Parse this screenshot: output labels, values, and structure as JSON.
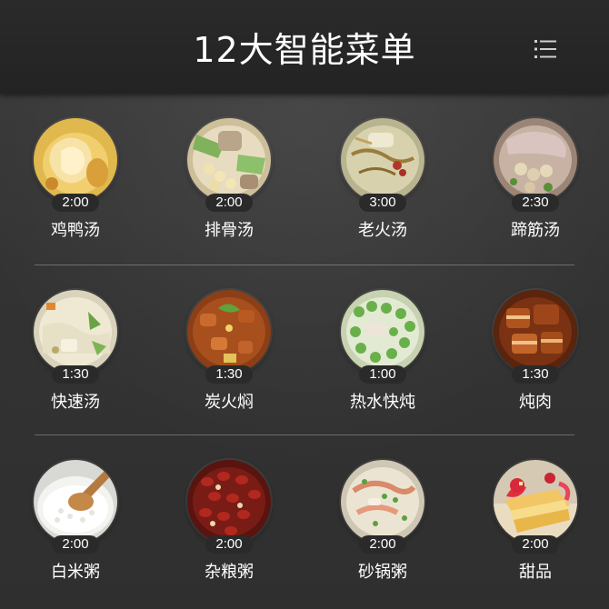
{
  "header": {
    "title": "12大智能菜单",
    "menu_icon": "hamburger-menu-icon"
  },
  "colors": {
    "background": "#333333",
    "header_background": "#252525",
    "text": "#ffffff",
    "time_badge": "#2a2a2a"
  },
  "menu": {
    "items": [
      {
        "label": "鸡鸭汤",
        "time": "2:00"
      },
      {
        "label": "排骨汤",
        "time": "2:00"
      },
      {
        "label": "老火汤",
        "time": "3:00"
      },
      {
        "label": "蹄筋汤",
        "time": "2:30"
      },
      {
        "label": "快速汤",
        "time": "1:30"
      },
      {
        "label": "炭火焖",
        "time": "1:30"
      },
      {
        "label": "热水快炖",
        "time": "1:00"
      },
      {
        "label": "炖肉",
        "time": "1:30"
      },
      {
        "label": "白米粥",
        "time": "2:00"
      },
      {
        "label": "杂粮粥",
        "time": "2:00"
      },
      {
        "label": "砂锅粥",
        "time": "2:00"
      },
      {
        "label": "甜品",
        "time": "2:00"
      }
    ]
  }
}
